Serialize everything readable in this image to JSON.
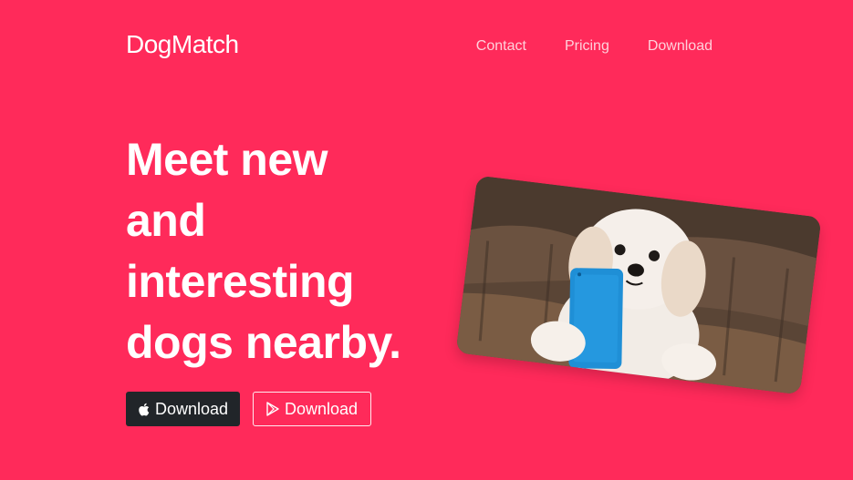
{
  "brand": {
    "name": "DogMatch"
  },
  "nav": {
    "items": [
      {
        "label": "Contact"
      },
      {
        "label": "Pricing"
      },
      {
        "label": "Download"
      }
    ]
  },
  "hero": {
    "title_lines": [
      "Meet new",
      "and",
      "interesting",
      "dogs nearby."
    ]
  },
  "buttons": {
    "apple_label": "Download",
    "play_label": "Download"
  },
  "colors": {
    "background": "#ff2a5a",
    "dark_button": "#212529",
    "phone_blue": "#1f8fd6"
  },
  "icons": {
    "apple": "apple-icon",
    "play": "play-store-icon"
  }
}
